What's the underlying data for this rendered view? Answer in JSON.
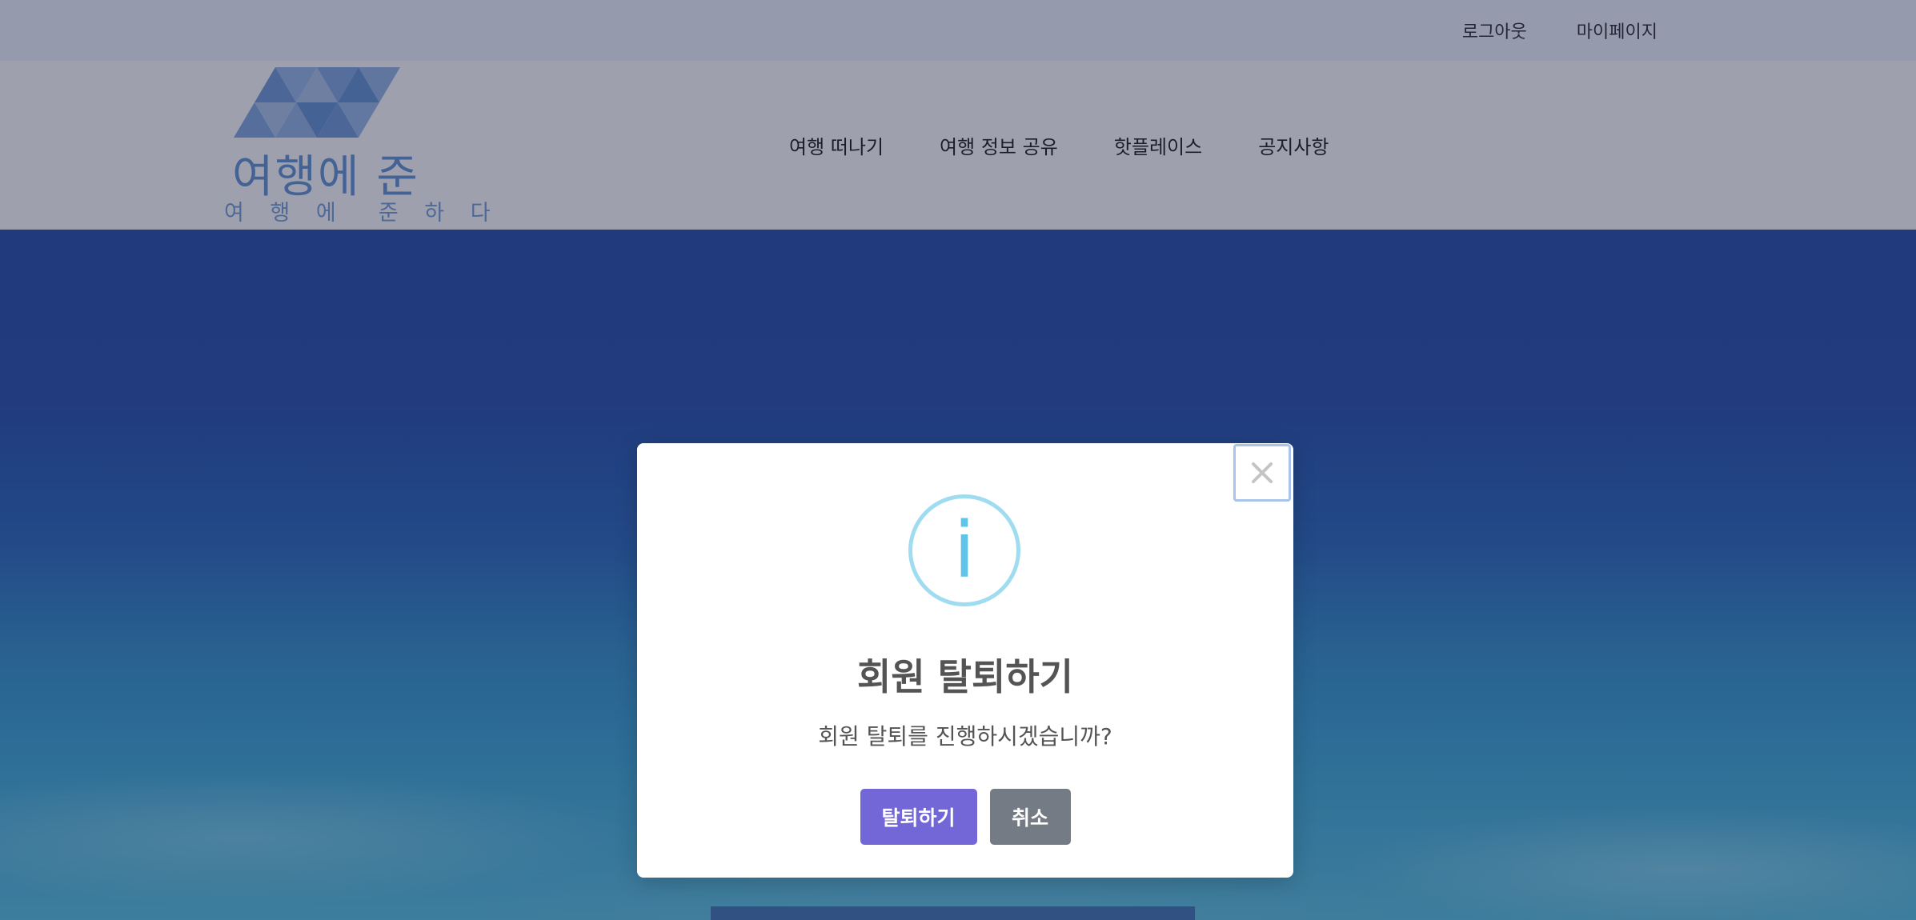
{
  "topbar": {
    "logout_label": "로그아웃",
    "mypage_label": "마이페이지"
  },
  "logo": {
    "main_text": "여행에 준",
    "sub_text": "여 행 에  준 하 다"
  },
  "nav": {
    "items": [
      {
        "label": "여행 떠나기"
      },
      {
        "label": "여행 정보 공유"
      },
      {
        "label": "핫플레이스"
      },
      {
        "label": "공지사항"
      }
    ]
  },
  "modal": {
    "icon_symbol": "i",
    "title": "회원 탈퇴하기",
    "message": "회원 탈퇴를 진행하시겠습니까?",
    "confirm_label": "탈퇴하기",
    "cancel_label": "취소",
    "close_icon": "close-icon"
  },
  "colors": {
    "confirm_button": "#7367d8",
    "cancel_button": "#757b84",
    "info_icon": "#5fc4ea",
    "logo": "#5d8fd1"
  }
}
